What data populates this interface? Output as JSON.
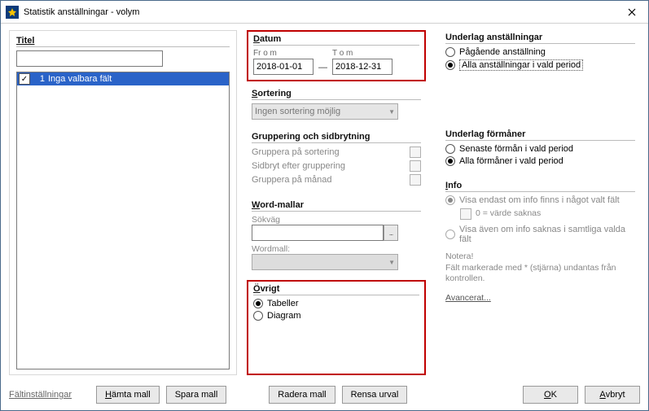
{
  "window": {
    "title": "Statistik anställningar - volym"
  },
  "left": {
    "titel_label": "Titel",
    "list_item_num": "1",
    "list_item_text": "Inga valbara fält"
  },
  "datum": {
    "heading": "Datum",
    "from_label": "Fr o m",
    "to_label": "T o m",
    "from_value": "2018-01-01",
    "to_value": "2018-12-31"
  },
  "sortering": {
    "heading": "Sortering",
    "combo_value": "Ingen sortering möjlig"
  },
  "gruppering": {
    "heading": "Gruppering och sidbrytning",
    "opt1": "Gruppera på sortering",
    "opt2": "Sidbryt efter gruppering",
    "opt3": "Gruppera på månad"
  },
  "word": {
    "heading": "Word-mallar",
    "sokvag_label": "Sökväg",
    "mall_label": "Wordmall:",
    "browse_label": "..."
  },
  "ovrigt": {
    "heading": "Övrigt",
    "opt1": "Tabeller",
    "opt2": "Diagram"
  },
  "underlag_anst": {
    "heading": "Underlag anställningar",
    "opt1": "Pågående anställning",
    "opt2": "Alla anställningar i vald period"
  },
  "underlag_form": {
    "heading": "Underlag förmåner",
    "opt1": "Senaste förmån i vald period",
    "opt2": "Alla förmåner i vald period"
  },
  "info": {
    "heading": "Info",
    "opt1": "Visa endast om info finns i något valt fält",
    "chk_label": "0 = värde saknas",
    "opt2": "Visa även om info saknas i samtliga valda fält",
    "note1": "Notera!",
    "note2": "Fält markerade med * (stjärna) undantas från kontrollen.",
    "advanced": "Avancerat..."
  },
  "buttons": {
    "faltinst": "Fältinställningar",
    "hamta": "Hämta mall",
    "spara": "Spara mall",
    "radera": "Radera mall",
    "rensa": "Rensa urval",
    "ok": "OK",
    "avbryt": "Avbryt"
  }
}
